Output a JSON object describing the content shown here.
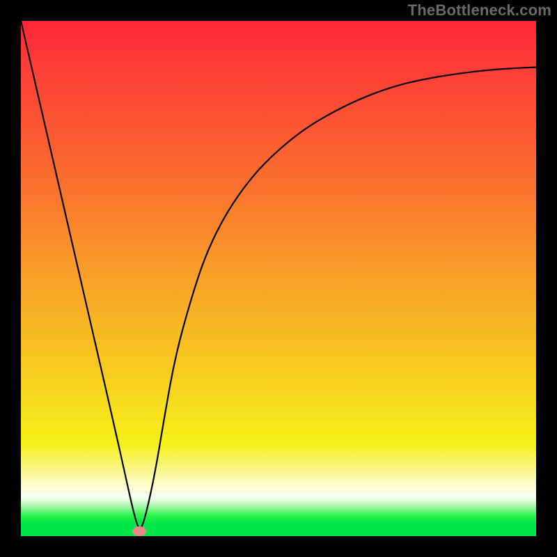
{
  "watermark": "TheBottleneck.com",
  "colors": {
    "frame": "#000000",
    "curve": "#000000",
    "marker": "#e98a88",
    "gradient_top": "#fd2637",
    "gradient_bottom": "#00e648"
  },
  "chart_data": {
    "type": "line",
    "title": "",
    "xlabel": "",
    "ylabel": "",
    "xlim": [
      0,
      100
    ],
    "ylim": [
      0,
      100
    ],
    "grid": false,
    "legend": false,
    "annotations": [],
    "series": [
      {
        "name": "bottleneck-curve",
        "x": [
          0,
          3,
          6,
          9,
          12,
          15,
          18,
          20,
          22,
          23,
          24,
          26,
          28,
          30,
          33,
          36,
          40,
          45,
          50,
          55,
          60,
          65,
          70,
          75,
          80,
          85,
          90,
          95,
          100
        ],
        "values": [
          100,
          87,
          74,
          61,
          48,
          35,
          22,
          13,
          4,
          1,
          3,
          12,
          24,
          35,
          46,
          55,
          63,
          70,
          75,
          79,
          82,
          84.5,
          86.5,
          88,
          89,
          89.8,
          90.4,
          90.8,
          91
        ]
      }
    ],
    "marker": {
      "x": 23,
      "y": 1
    }
  }
}
